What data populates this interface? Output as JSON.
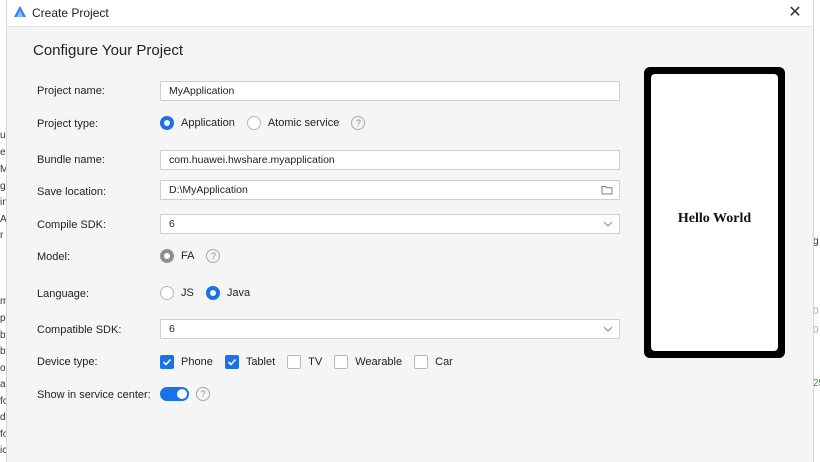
{
  "window": {
    "title": "Create Project"
  },
  "page": {
    "heading": "Configure Your Project"
  },
  "background": {
    "left_fragments": [
      "ua",
      "e",
      "M",
      "g",
      "in",
      "A",
      "r",
      "m",
      "p",
      "b",
      "b",
      "ou",
      "al",
      "fo",
      "d",
      "fo",
      "ic"
    ],
    "right_fragments": [
      "g",
      "0",
      "0",
      "25"
    ]
  },
  "form": {
    "project_name": {
      "label": "Project name:",
      "value": "MyApplication"
    },
    "project_type": {
      "label": "Project type:",
      "options": [
        "Application",
        "Atomic service"
      ],
      "selected": "Application"
    },
    "bundle_name": {
      "label": "Bundle name:",
      "value": "com.huawei.hwshare.myapplication"
    },
    "save_location": {
      "label": "Save location:",
      "value": "D:\\MyApplication"
    },
    "compile_sdk": {
      "label": "Compile SDK:",
      "value": "6"
    },
    "model": {
      "label": "Model:",
      "options": [
        "FA"
      ],
      "selected": "FA"
    },
    "language": {
      "label": "Language:",
      "options": [
        "JS",
        "Java"
      ],
      "selected": "Java"
    },
    "compatible_sdk": {
      "label": "Compatible SDK:",
      "value": "6"
    },
    "device_type": {
      "label": "Device type:",
      "options": [
        {
          "name": "Phone",
          "checked": true
        },
        {
          "name": "Tablet",
          "checked": true
        },
        {
          "name": "TV",
          "checked": false
        },
        {
          "name": "Wearable",
          "checked": false
        },
        {
          "name": "Car",
          "checked": false
        }
      ]
    },
    "service_center": {
      "label": "Show in service center:",
      "enabled": true
    }
  },
  "preview": {
    "text": "Hello World"
  },
  "icons": {
    "app": "harmony-logo-icon",
    "close": "close-icon",
    "folder": "folder-icon",
    "chevron": "chevron-down-icon",
    "help": "help-icon"
  },
  "colors": {
    "accent": "#1a72e8",
    "locked": "#8e8e8e"
  }
}
